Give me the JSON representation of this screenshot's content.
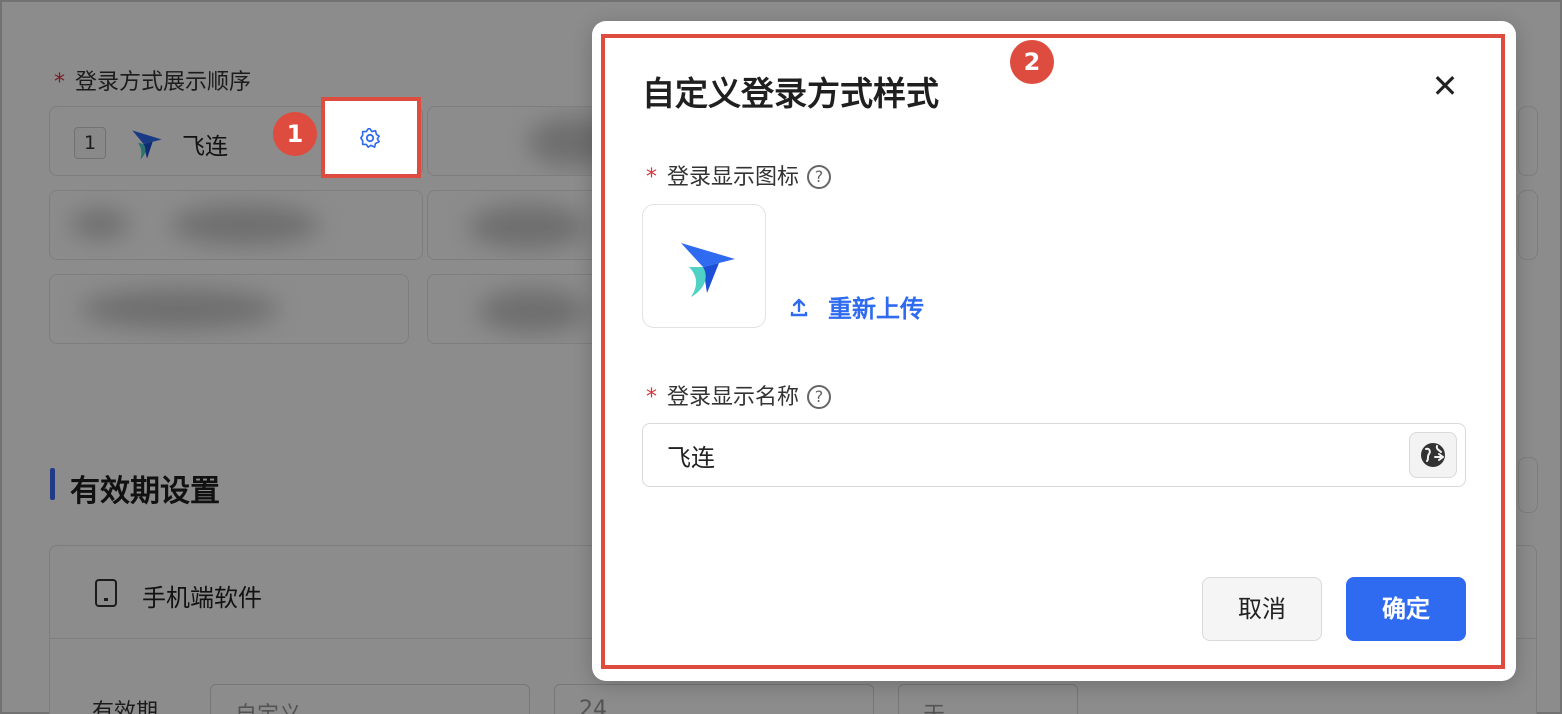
{
  "background": {
    "field_label": "登录方式展示顺序",
    "item_index": "1",
    "item_name": "飞连",
    "section_title": "有效期设置",
    "mobile_label": "手机端软件",
    "validity_label": "有效期",
    "validity_select": "自定义",
    "validity_number": "24",
    "validity_unit": "天"
  },
  "annotations": {
    "marker_1": "1",
    "marker_2": "2"
  },
  "modal": {
    "title": "自定义登录方式样式",
    "close_glyph": "✕",
    "icon_label": "登录显示图标",
    "reupload_label": "重新上传",
    "name_label": "登录显示名称",
    "name_value": "飞连",
    "cancel_label": "取消",
    "ok_label": "确定"
  },
  "required_mark": "*",
  "help_glyph": "?",
  "colors": {
    "primary": "#2f6bf0",
    "required": "#d9363e",
    "annotation": "#de4b3f"
  },
  "icons": {
    "settings": "gear-icon",
    "upload": "upload-icon",
    "translate": "globe-icon",
    "device": "phone-icon",
    "logo": "feilian-logo-icon"
  }
}
